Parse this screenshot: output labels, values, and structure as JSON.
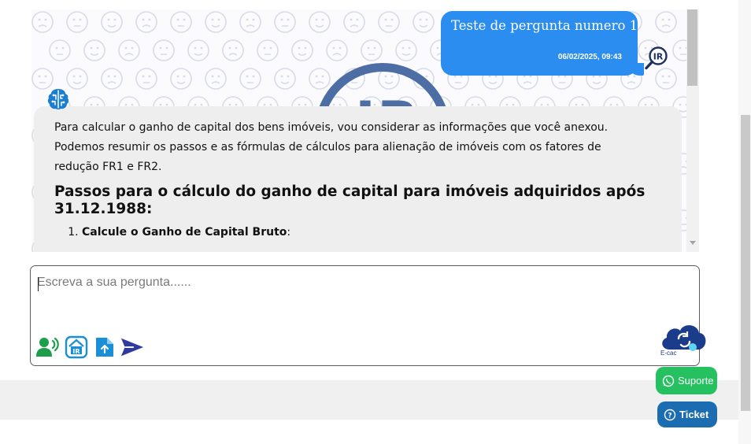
{
  "chat": {
    "user_message": {
      "text": "Teste de pergunta numero 1",
      "timestamp": "06/02/2025, 09:43",
      "avatar_icon": "ir-magnifier-icon"
    },
    "bot_message": {
      "avatar_icon": "brain-circuit-icon",
      "paragraph_1": "Para calcular o ganho de capital dos bens imóveis, vou considerar as informações que você anexou.",
      "paragraph_2": "Podemos resumir os passos e as fórmulas de cálculos para alienação de imóveis com os fatores de",
      "paragraph_3": "redução FR1 e FR2.",
      "heading": "Passos para o cálculo do ganho de capital para imóveis adquiridos após 31.12.1988:",
      "list_items": [
        {
          "number": "1.",
          "bold": "Calcule o Ganho de Capital Bruto",
          "suffix": ":"
        }
      ]
    },
    "watermark_text": "IR"
  },
  "input": {
    "placeholder": "Escreva a sua pergunta......",
    "tools": [
      {
        "icon": "voice-speaker-icon",
        "color": "#1e9e4a"
      },
      {
        "icon": "ir-document-icon",
        "color": "#1a8fd8"
      },
      {
        "icon": "file-upload-icon",
        "color": "#1a8fd8"
      },
      {
        "icon": "send-icon",
        "color": "#2e3a9e"
      }
    ]
  },
  "floating": {
    "ecac_label": "E-cac",
    "suporte_label": "Suporte",
    "ticket_label": "Ticket"
  },
  "colors": {
    "user_bubble": "#2b8df0",
    "bot_bubble": "#eeeeee",
    "suporte": "#25c160",
    "ticket": "#1b6cb0"
  }
}
